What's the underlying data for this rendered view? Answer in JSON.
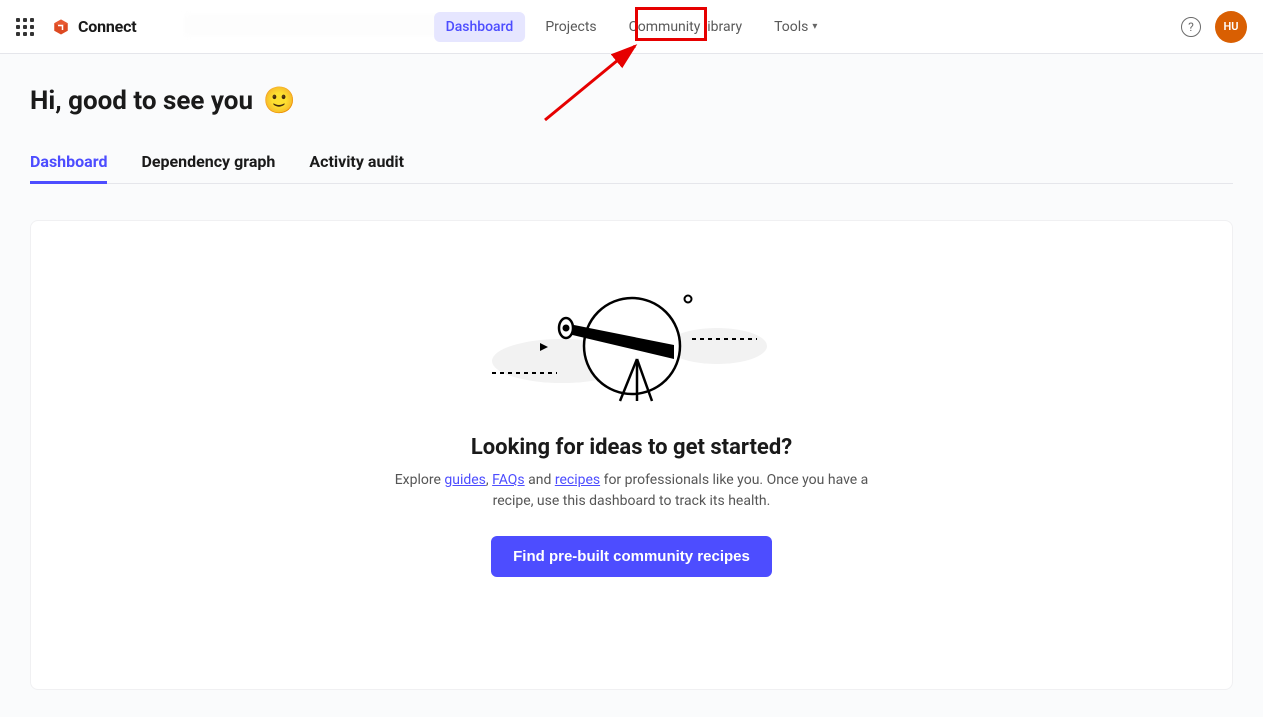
{
  "brand": {
    "name": "Connect"
  },
  "nav": {
    "dashboard": "Dashboard",
    "projects": "Projects",
    "community": "Community library",
    "tools": "Tools"
  },
  "avatar_initials": "HU",
  "greeting_text": "Hi, good to see you",
  "greeting_emoji": "🙂",
  "tabs": {
    "dashboard": "Dashboard",
    "dependency": "Dependency graph",
    "activity": "Activity audit"
  },
  "empty": {
    "title": "Looking for ideas to get started?",
    "sub_prefix": "Explore ",
    "link_guides": "guides",
    "link_faqs": "FAQs",
    "link_recipes": "recipes",
    "sub_suffix": " for professionals like you. Once you have a recipe, use this dashboard to track its health.",
    "button": "Find pre-built community recipes"
  }
}
